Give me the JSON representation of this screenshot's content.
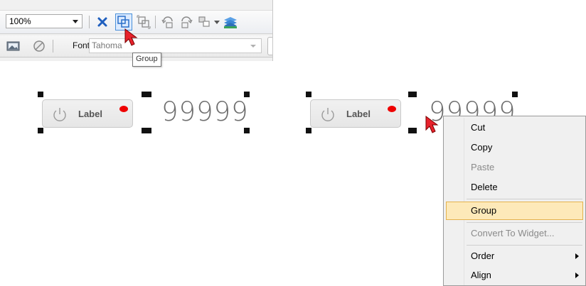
{
  "toolbar": {
    "zoom_value": "100%",
    "font_label": "Font",
    "font_value": "Tahoma",
    "tooltip": "Group"
  },
  "canvas": {
    "widgets": [
      {
        "label": "Label",
        "value": "99999"
      },
      {
        "label": "Label",
        "value": "99999"
      }
    ],
    "colors": {
      "led": "#ee0000",
      "handle": "#111111"
    }
  },
  "context_menu": {
    "items": [
      {
        "label": "Cut",
        "enabled": true
      },
      {
        "label": "Copy",
        "enabled": true
      },
      {
        "label": "Paste",
        "enabled": false
      },
      {
        "label": "Delete",
        "enabled": true
      },
      {
        "label": "Group",
        "enabled": true,
        "highlighted": true
      },
      {
        "label": "Convert To Widget...",
        "enabled": false
      },
      {
        "label": "Order",
        "enabled": true,
        "submenu": true
      },
      {
        "label": "Align",
        "enabled": true,
        "submenu": true
      }
    ],
    "highlight_color": "#fde9b9"
  },
  "icons": [
    "close-x-icon",
    "group-icon",
    "ungroup-icon",
    "rotate-left-icon",
    "rotate-right-icon",
    "arrange-icon",
    "layers-icon",
    "image-icon",
    "disable-icon",
    "power-icon",
    "mouse-cursor-icon"
  ]
}
